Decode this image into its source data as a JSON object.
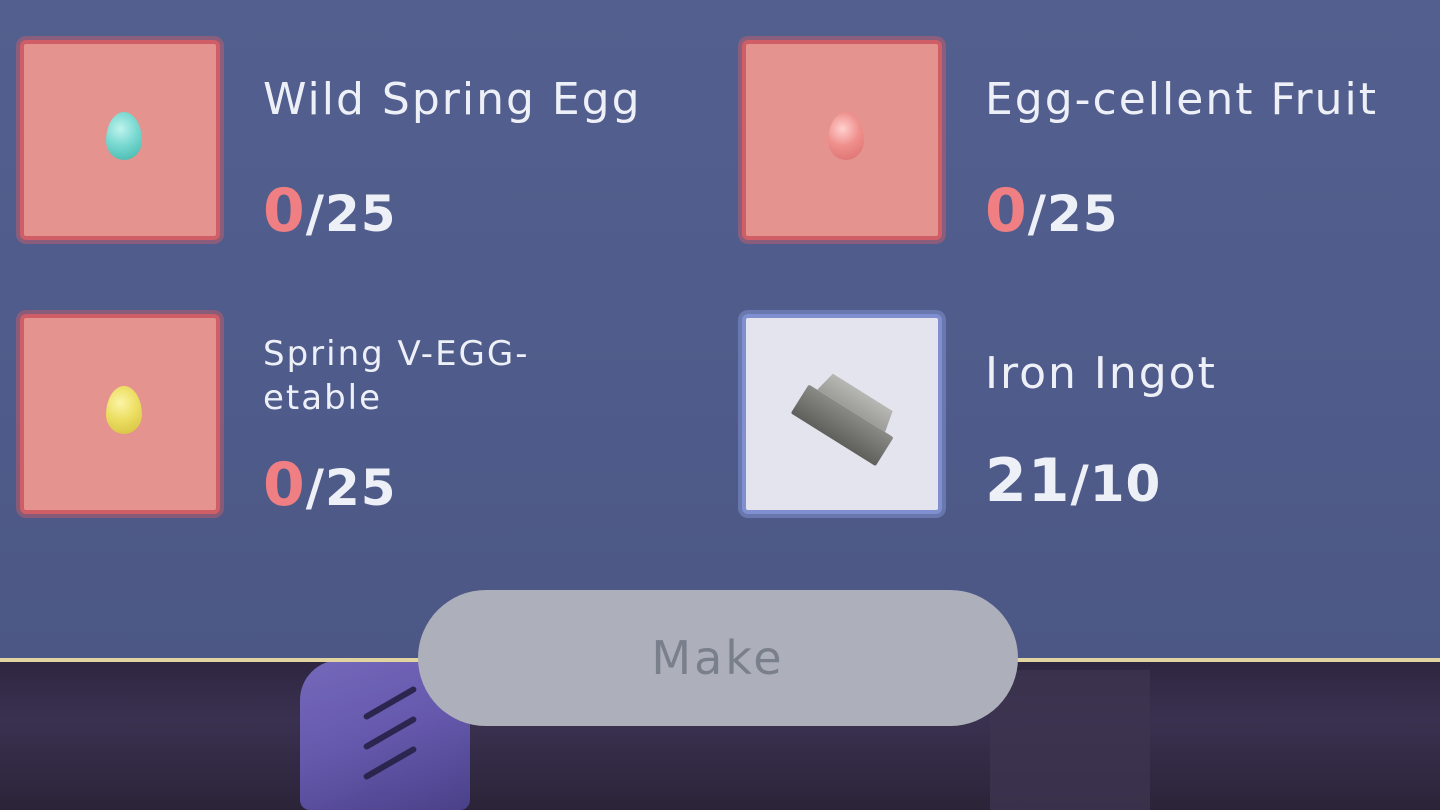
{
  "items": [
    {
      "name": "Wild Spring Egg",
      "have": "0",
      "need": "/25",
      "icon": "teal-egg-icon",
      "sufficient": false
    },
    {
      "name": "Egg-cellent Fruit",
      "have": "0",
      "need": "/25",
      "icon": "pink-egg-icon",
      "sufficient": false
    },
    {
      "name": "Spring V-EGG-etable",
      "have": "0",
      "need": "/25",
      "icon": "yellow-egg-icon",
      "sufficient": false
    },
    {
      "name": "Iron Ingot",
      "have": "21",
      "need": "/10",
      "icon": "iron-ingot-icon",
      "sufficient": true
    }
  ],
  "make_button": {
    "label": "Make",
    "enabled": false
  },
  "colors": {
    "panel": "#53608f",
    "missing_slot": "#e5938f",
    "missing_border": "#cf5e66",
    "ok_slot": "#e4e4ee",
    "ok_border": "#7f8fd0",
    "short_count": "#ef7f82",
    "accent_line": "#e2d4a0",
    "button": "#adb0ba"
  }
}
